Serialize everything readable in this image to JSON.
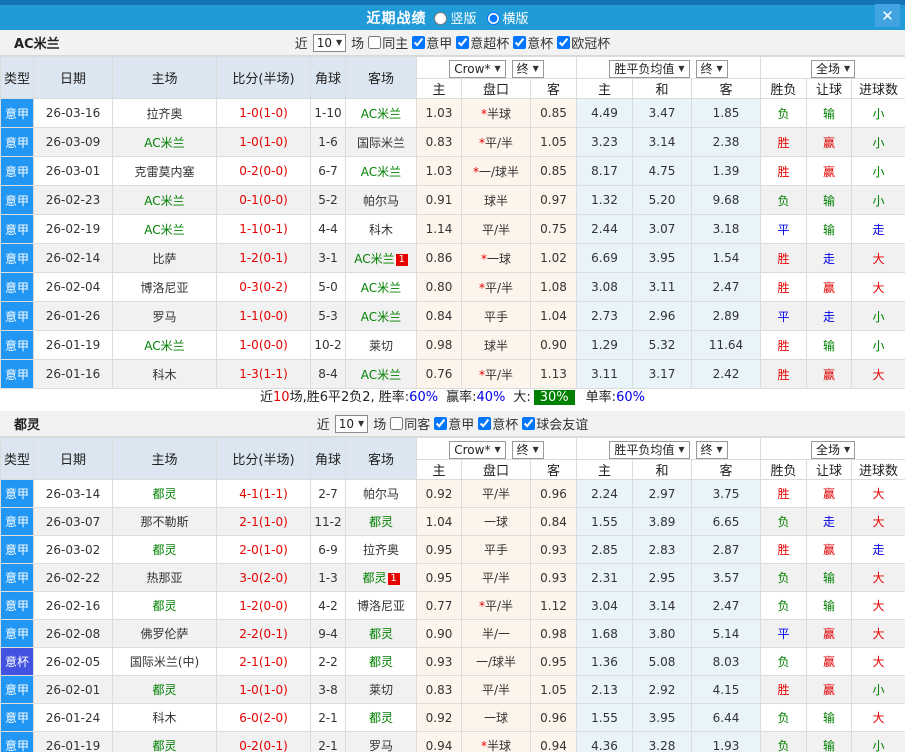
{
  "window": {
    "title": "近期战绩",
    "view_options": [
      {
        "label": "竖版",
        "selected": false
      },
      {
        "label": "横版",
        "selected": true
      }
    ],
    "close_label": "✕"
  },
  "colors": {
    "titlebar": "#209bd8",
    "titlebar_top_strip": "#1373b4",
    "close_button": "#41a4e0",
    "league_type_bg": "#2196f3",
    "cup_type_bg": "#4153e0",
    "focus_team_green": "#008000",
    "win_red": "#e60000",
    "draw_blue": "#0000ee",
    "odds_column_bg": "#fdf4ec",
    "avg_column_bg": "#e9f3fa",
    "header_bg": "#dce6f0",
    "big_rate_box_bg": "#008000"
  },
  "table_header": {
    "main": [
      "类型",
      "日期",
      "主场",
      "比分(半场)",
      "角球",
      "客场"
    ],
    "selects": {
      "odds_company": "Crow*",
      "odds_period": "终",
      "avg_label": "胜平负均值",
      "avg_period": "终",
      "scope": "全场"
    },
    "sub": [
      "主",
      "盘口",
      "客",
      "主",
      "和",
      "客",
      "胜负",
      "让球",
      "进球数"
    ]
  },
  "sections": [
    {
      "team": "AC米兰",
      "filter": {
        "recent_label": "近",
        "count": "10",
        "games_label": "场",
        "checkboxes": [
          {
            "label": "同主",
            "checked": false
          },
          {
            "label": "意甲",
            "checked": true
          },
          {
            "label": "意超杯",
            "checked": true
          },
          {
            "label": "意杯",
            "checked": true
          },
          {
            "label": "欧冠杯",
            "checked": true
          }
        ]
      },
      "rows": [
        {
          "type": "意甲",
          "type_style": "league",
          "date": "26-03-16",
          "home": {
            "name": "拉齐奥",
            "focus": false
          },
          "score": "1-0(1-0)",
          "corners": "1-10",
          "away": {
            "name": "AC米兰",
            "focus": true
          },
          "odds": {
            "home": "1.03",
            "star": true,
            "handicap": "半球",
            "away": "0.85"
          },
          "avg": {
            "home": "4.49",
            "draw": "3.47",
            "away": "1.85"
          },
          "result": {
            "text": "负",
            "color": "green"
          },
          "handicap_result": {
            "text": "输",
            "color": "green"
          },
          "goals": {
            "text": "小",
            "color": "green"
          }
        },
        {
          "type": "意甲",
          "type_style": "league",
          "date": "26-03-09",
          "home": {
            "name": "AC米兰",
            "focus": true
          },
          "score": "1-0(1-0)",
          "corners": "1-6",
          "away": {
            "name": "国际米兰",
            "focus": false
          },
          "odds": {
            "home": "0.83",
            "star": true,
            "handicap": "平/半",
            "away": "1.05"
          },
          "avg": {
            "home": "3.23",
            "draw": "3.14",
            "away": "2.38"
          },
          "result": {
            "text": "胜",
            "color": "red"
          },
          "handicap_result": {
            "text": "赢",
            "color": "red"
          },
          "goals": {
            "text": "小",
            "color": "green"
          }
        },
        {
          "type": "意甲",
          "type_style": "league",
          "date": "26-03-01",
          "home": {
            "name": "克雷莫内塞",
            "focus": false
          },
          "score": "0-2(0-0)",
          "corners": "6-7",
          "away": {
            "name": "AC米兰",
            "focus": true
          },
          "odds": {
            "home": "1.03",
            "star": true,
            "handicap": "一/球半",
            "away": "0.85"
          },
          "avg": {
            "home": "8.17",
            "draw": "4.75",
            "away": "1.39"
          },
          "result": {
            "text": "胜",
            "color": "red"
          },
          "handicap_result": {
            "text": "赢",
            "color": "red"
          },
          "goals": {
            "text": "小",
            "color": "green"
          }
        },
        {
          "type": "意甲",
          "type_style": "league",
          "date": "26-02-23",
          "home": {
            "name": "AC米兰",
            "focus": true
          },
          "score": "0-1(0-0)",
          "corners": "5-2",
          "away": {
            "name": "帕尔马",
            "focus": false
          },
          "odds": {
            "home": "0.91",
            "star": false,
            "handicap": "球半",
            "away": "0.97"
          },
          "avg": {
            "home": "1.32",
            "draw": "5.20",
            "away": "9.68"
          },
          "result": {
            "text": "负",
            "color": "green"
          },
          "handicap_result": {
            "text": "输",
            "color": "green"
          },
          "goals": {
            "text": "小",
            "color": "green"
          }
        },
        {
          "type": "意甲",
          "type_style": "league",
          "date": "26-02-19",
          "home": {
            "name": "AC米兰",
            "focus": true
          },
          "score": "1-1(0-1)",
          "corners": "4-4",
          "away": {
            "name": "科木",
            "focus": false
          },
          "odds": {
            "home": "1.14",
            "star": false,
            "handicap": "平/半",
            "away": "0.75"
          },
          "avg": {
            "home": "2.44",
            "draw": "3.07",
            "away": "3.18"
          },
          "result": {
            "text": "平",
            "color": "blue"
          },
          "handicap_result": {
            "text": "输",
            "color": "green"
          },
          "goals": {
            "text": "走",
            "color": "blue"
          }
        },
        {
          "type": "意甲",
          "type_style": "league",
          "date": "26-02-14",
          "home": {
            "name": "比萨",
            "focus": false
          },
          "score": "1-2(0-1)",
          "corners": "3-1",
          "away": {
            "name": "AC米兰",
            "focus": true,
            "badge": "1"
          },
          "odds": {
            "home": "0.86",
            "star": true,
            "handicap": "一球",
            "away": "1.02"
          },
          "avg": {
            "home": "6.69",
            "draw": "3.95",
            "away": "1.54"
          },
          "result": {
            "text": "胜",
            "color": "red"
          },
          "handicap_result": {
            "text": "走",
            "color": "blue"
          },
          "goals": {
            "text": "大",
            "color": "red"
          }
        },
        {
          "type": "意甲",
          "type_style": "league",
          "date": "26-02-04",
          "home": {
            "name": "博洛尼亚",
            "focus": false
          },
          "score": "0-3(0-2)",
          "corners": "5-0",
          "away": {
            "name": "AC米兰",
            "focus": true
          },
          "odds": {
            "home": "0.80",
            "star": true,
            "handicap": "平/半",
            "away": "1.08"
          },
          "avg": {
            "home": "3.08",
            "draw": "3.11",
            "away": "2.47"
          },
          "result": {
            "text": "胜",
            "color": "red"
          },
          "handicap_result": {
            "text": "赢",
            "color": "red"
          },
          "goals": {
            "text": "大",
            "color": "red"
          }
        },
        {
          "type": "意甲",
          "type_style": "league",
          "date": "26-01-26",
          "home": {
            "name": "罗马",
            "focus": false
          },
          "score": "1-1(0-0)",
          "corners": "5-3",
          "away": {
            "name": "AC米兰",
            "focus": true
          },
          "odds": {
            "home": "0.84",
            "star": false,
            "handicap": "平手",
            "away": "1.04"
          },
          "avg": {
            "home": "2.73",
            "draw": "2.96",
            "away": "2.89"
          },
          "result": {
            "text": "平",
            "color": "blue"
          },
          "handicap_result": {
            "text": "走",
            "color": "blue"
          },
          "goals": {
            "text": "小",
            "color": "green"
          }
        },
        {
          "type": "意甲",
          "type_style": "league",
          "date": "26-01-19",
          "home": {
            "name": "AC米兰",
            "focus": true
          },
          "score": "1-0(0-0)",
          "corners": "10-2",
          "away": {
            "name": "莱切",
            "focus": false
          },
          "odds": {
            "home": "0.98",
            "star": false,
            "handicap": "球半",
            "away": "0.90"
          },
          "avg": {
            "home": "1.29",
            "draw": "5.32",
            "away": "11.64"
          },
          "result": {
            "text": "胜",
            "color": "red"
          },
          "handicap_result": {
            "text": "输",
            "color": "green"
          },
          "goals": {
            "text": "小",
            "color": "green"
          }
        },
        {
          "type": "意甲",
          "type_style": "league",
          "date": "26-01-16",
          "home": {
            "name": "科木",
            "focus": false
          },
          "score": "1-3(1-1)",
          "corners": "8-4",
          "away": {
            "name": "AC米兰",
            "focus": true
          },
          "odds": {
            "home": "0.76",
            "star": true,
            "handicap": "平/半",
            "away": "1.13"
          },
          "avg": {
            "home": "3.11",
            "draw": "3.17",
            "away": "2.42"
          },
          "result": {
            "text": "胜",
            "color": "red"
          },
          "handicap_result": {
            "text": "赢",
            "color": "red"
          },
          "goals": {
            "text": "大",
            "color": "red"
          }
        }
      ],
      "summary": {
        "prefix": "近",
        "count": "10",
        "record_text": "场,胜6平2负2, 胜率:",
        "win_rate": "60%",
        "handicap_label": "赢率:",
        "handicap_rate": "40%",
        "big_label": "大:",
        "big_rate": "30%",
        "single_label": "单率:",
        "single_rate": "60%"
      }
    },
    {
      "team": "都灵",
      "filter": {
        "recent_label": "近",
        "count": "10",
        "games_label": "场",
        "checkboxes": [
          {
            "label": "同客",
            "checked": false
          },
          {
            "label": "意甲",
            "checked": true
          },
          {
            "label": "意杯",
            "checked": true
          },
          {
            "label": "球会友谊",
            "checked": true
          }
        ]
      },
      "rows": [
        {
          "type": "意甲",
          "type_style": "league",
          "date": "26-03-14",
          "home": {
            "name": "都灵",
            "focus": true
          },
          "score": "4-1(1-1)",
          "corners": "2-7",
          "away": {
            "name": "帕尔马",
            "focus": false
          },
          "odds": {
            "home": "0.92",
            "star": false,
            "handicap": "平/半",
            "away": "0.96"
          },
          "avg": {
            "home": "2.24",
            "draw": "2.97",
            "away": "3.75"
          },
          "result": {
            "text": "胜",
            "color": "red"
          },
          "handicap_result": {
            "text": "赢",
            "color": "red"
          },
          "goals": {
            "text": "大",
            "color": "red"
          }
        },
        {
          "type": "意甲",
          "type_style": "league",
          "date": "26-03-07",
          "home": {
            "name": "那不勒斯",
            "focus": false
          },
          "score": "2-1(1-0)",
          "corners": "11-2",
          "away": {
            "name": "都灵",
            "focus": true
          },
          "odds": {
            "home": "1.04",
            "star": false,
            "handicap": "一球",
            "away": "0.84"
          },
          "avg": {
            "home": "1.55",
            "draw": "3.89",
            "away": "6.65"
          },
          "result": {
            "text": "负",
            "color": "green"
          },
          "handicap_result": {
            "text": "走",
            "color": "blue"
          },
          "goals": {
            "text": "大",
            "color": "red"
          }
        },
        {
          "type": "意甲",
          "type_style": "league",
          "date": "26-03-02",
          "home": {
            "name": "都灵",
            "focus": true
          },
          "score": "2-0(1-0)",
          "corners": "6-9",
          "away": {
            "name": "拉齐奥",
            "focus": false
          },
          "odds": {
            "home": "0.95",
            "star": false,
            "handicap": "平手",
            "away": "0.93"
          },
          "avg": {
            "home": "2.85",
            "draw": "2.83",
            "away": "2.87"
          },
          "result": {
            "text": "胜",
            "color": "red"
          },
          "handicap_result": {
            "text": "赢",
            "color": "red"
          },
          "goals": {
            "text": "走",
            "color": "blue"
          }
        },
        {
          "type": "意甲",
          "type_style": "league",
          "date": "26-02-22",
          "home": {
            "name": "热那亚",
            "focus": false
          },
          "score": "3-0(2-0)",
          "corners": "1-3",
          "away": {
            "name": "都灵",
            "focus": true,
            "badge": "1"
          },
          "odds": {
            "home": "0.95",
            "star": false,
            "handicap": "平/半",
            "away": "0.93"
          },
          "avg": {
            "home": "2.31",
            "draw": "2.95",
            "away": "3.57"
          },
          "result": {
            "text": "负",
            "color": "green"
          },
          "handicap_result": {
            "text": "输",
            "color": "green"
          },
          "goals": {
            "text": "大",
            "color": "red"
          }
        },
        {
          "type": "意甲",
          "type_style": "league",
          "date": "26-02-16",
          "home": {
            "name": "都灵",
            "focus": true
          },
          "score": "1-2(0-0)",
          "corners": "4-2",
          "away": {
            "name": "博洛尼亚",
            "focus": false
          },
          "odds": {
            "home": "0.77",
            "star": true,
            "handicap": "平/半",
            "away": "1.12"
          },
          "avg": {
            "home": "3.04",
            "draw": "3.14",
            "away": "2.47"
          },
          "result": {
            "text": "负",
            "color": "green"
          },
          "handicap_result": {
            "text": "输",
            "color": "green"
          },
          "goals": {
            "text": "大",
            "color": "red"
          }
        },
        {
          "type": "意甲",
          "type_style": "league",
          "date": "26-02-08",
          "home": {
            "name": "佛罗伦萨",
            "focus": false
          },
          "score": "2-2(0-1)",
          "corners": "9-4",
          "away": {
            "name": "都灵",
            "focus": true
          },
          "odds": {
            "home": "0.90",
            "star": false,
            "handicap": "半/一",
            "away": "0.98"
          },
          "avg": {
            "home": "1.68",
            "draw": "3.80",
            "away": "5.14"
          },
          "result": {
            "text": "平",
            "color": "blue"
          },
          "handicap_result": {
            "text": "赢",
            "color": "red"
          },
          "goals": {
            "text": "大",
            "color": "red"
          }
        },
        {
          "type": "意杯",
          "type_style": "cup",
          "date": "26-02-05",
          "home": {
            "name": "国际米兰(中)",
            "focus": false
          },
          "score": "2-1(1-0)",
          "corners": "2-2",
          "away": {
            "name": "都灵",
            "focus": true
          },
          "odds": {
            "home": "0.93",
            "star": false,
            "handicap": "一/球半",
            "away": "0.95"
          },
          "avg": {
            "home": "1.36",
            "draw": "5.08",
            "away": "8.03"
          },
          "result": {
            "text": "负",
            "color": "green"
          },
          "handicap_result": {
            "text": "赢",
            "color": "red"
          },
          "goals": {
            "text": "大",
            "color": "red"
          }
        },
        {
          "type": "意甲",
          "type_style": "league",
          "date": "26-02-01",
          "home": {
            "name": "都灵",
            "focus": true
          },
          "score": "1-0(1-0)",
          "corners": "3-8",
          "away": {
            "name": "莱切",
            "focus": false
          },
          "odds": {
            "home": "0.83",
            "star": false,
            "handicap": "平/半",
            "away": "1.05"
          },
          "avg": {
            "home": "2.13",
            "draw": "2.92",
            "away": "4.15"
          },
          "result": {
            "text": "胜",
            "color": "red"
          },
          "handicap_result": {
            "text": "赢",
            "color": "red"
          },
          "goals": {
            "text": "小",
            "color": "green"
          }
        },
        {
          "type": "意甲",
          "type_style": "league",
          "date": "26-01-24",
          "home": {
            "name": "科木",
            "focus": false
          },
          "score": "6-0(2-0)",
          "corners": "2-1",
          "away": {
            "name": "都灵",
            "focus": true
          },
          "odds": {
            "home": "0.92",
            "star": false,
            "handicap": "一球",
            "away": "0.96"
          },
          "avg": {
            "home": "1.55",
            "draw": "3.95",
            "away": "6.44"
          },
          "result": {
            "text": "负",
            "color": "green"
          },
          "handicap_result": {
            "text": "输",
            "color": "green"
          },
          "goals": {
            "text": "大",
            "color": "red"
          }
        },
        {
          "type": "意甲",
          "type_style": "league",
          "date": "26-01-19",
          "home": {
            "name": "都灵",
            "focus": true
          },
          "score": "0-2(0-1)",
          "corners": "2-1",
          "away": {
            "name": "罗马",
            "focus": false
          },
          "odds": {
            "home": "0.94",
            "star": true,
            "handicap": "半球",
            "away": "0.94"
          },
          "avg": {
            "home": "4.36",
            "draw": "3.28",
            "away": "1.93"
          },
          "result": {
            "text": "负",
            "color": "green"
          },
          "handicap_result": {
            "text": "输",
            "color": "green"
          },
          "goals": {
            "text": "小",
            "color": "green"
          }
        }
      ]
    }
  ]
}
